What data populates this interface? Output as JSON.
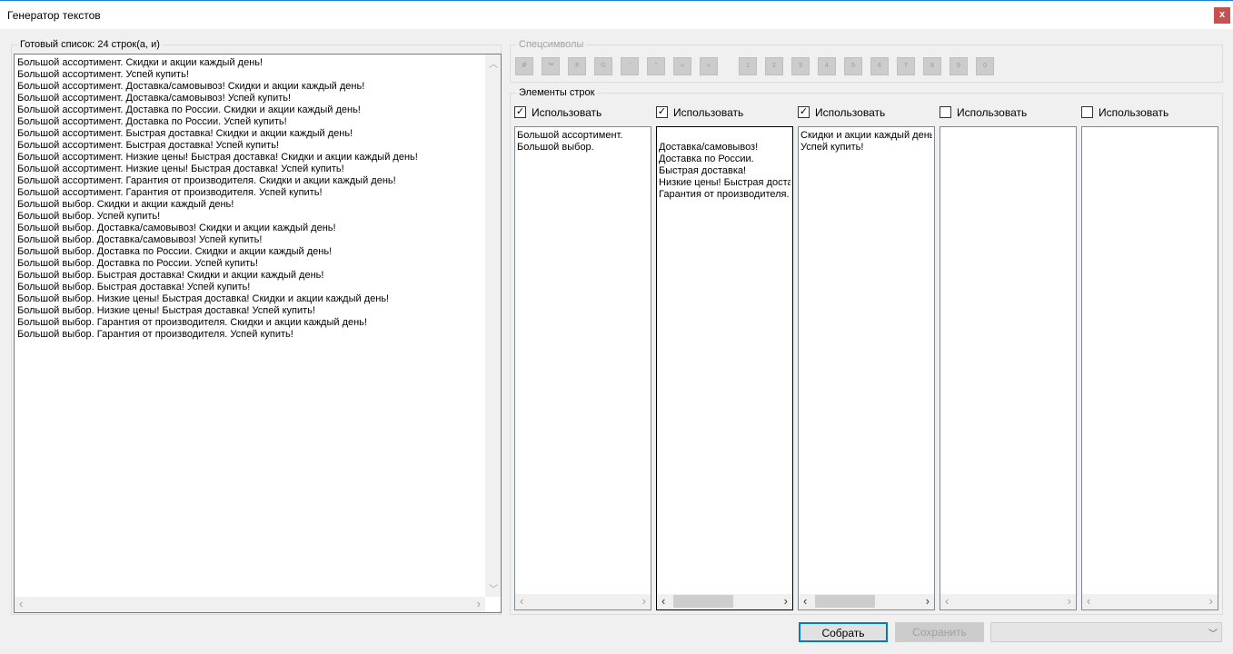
{
  "window": {
    "title": "Генератор текстов",
    "close": "x"
  },
  "result": {
    "label": "Готовый список: 24 строк(а, и)",
    "lines": [
      "Большой ассортимент. Скидки и акции каждый день!",
      "Большой ассортимент. Успей купить!",
      "Большой ассортимент. Доставка/самовывоз! Скидки и акции каждый день!",
      "Большой ассортимент. Доставка/самовывоз! Успей купить!",
      "Большой ассортимент. Доставка по России. Скидки и акции каждый день!",
      "Большой ассортимент. Доставка по России. Успей купить!",
      "Большой ассортимент. Быстрая доставка! Скидки и акции каждый день!",
      "Большой ассортимент. Быстрая доставка! Успей купить!",
      "Большой ассортимент. Низкие цены! Быстрая доставка! Скидки и акции каждый день!",
      "Большой ассортимент. Низкие цены! Быстрая доставка! Успей купить!",
      "Большой ассортимент. Гарантия от производителя. Скидки и акции каждый день!",
      "Большой ассортимент. Гарантия от производителя. Успей купить!",
      "Большой выбор. Скидки и акции каждый день!",
      "Большой выбор. Успей купить!",
      "Большой выбор. Доставка/самовывоз! Скидки и акции каждый день!",
      "Большой выбор. Доставка/самовывоз! Успей купить!",
      "Большой выбор. Доставка по России. Скидки и акции каждый день!",
      "Большой выбор. Доставка по России. Успей купить!",
      "Большой выбор. Быстрая доставка! Скидки и акции каждый день!",
      "Большой выбор. Быстрая доставка! Успей купить!",
      "Большой выбор. Низкие цены! Быстрая доставка! Скидки и акции каждый день!",
      "Большой выбор. Низкие цены! Быстрая доставка! Успей купить!",
      "Большой выбор. Гарантия от производителя. Скидки и акции каждый день!",
      "Большой выбор. Гарантия от производителя. Успей купить!"
    ]
  },
  "special": {
    "label": "Спецсимволы",
    "symbols": [
      "₽",
      "™",
      "®",
      "©",
      "'",
      "°",
      "«",
      "»"
    ],
    "digits": [
      "1",
      "2",
      "3",
      "4",
      "5",
      "6",
      "7",
      "8",
      "9",
      "0"
    ]
  },
  "elements": {
    "label": "Элементы строк",
    "columns": [
      {
        "use_label": "Использовать",
        "checked": true,
        "lines": [
          "Большой ассортимент.",
          "Большой выбор."
        ]
      },
      {
        "use_label": "Использовать",
        "checked": true,
        "lines": [
          "",
          "Доставка/самовывоз!",
          "Доставка по России.",
          "Быстрая доставка!",
          "Низкие цены! Быстрая доставка!",
          "Гарантия от производителя."
        ]
      },
      {
        "use_label": "Использовать",
        "checked": true,
        "lines": [
          "Скидки и акции каждый день!",
          "Успей купить!"
        ]
      },
      {
        "use_label": "Использовать",
        "checked": false,
        "lines": []
      },
      {
        "use_label": "Использовать",
        "checked": false,
        "lines": []
      }
    ]
  },
  "actions": {
    "build": "Собрать",
    "save": "Сохранить"
  }
}
